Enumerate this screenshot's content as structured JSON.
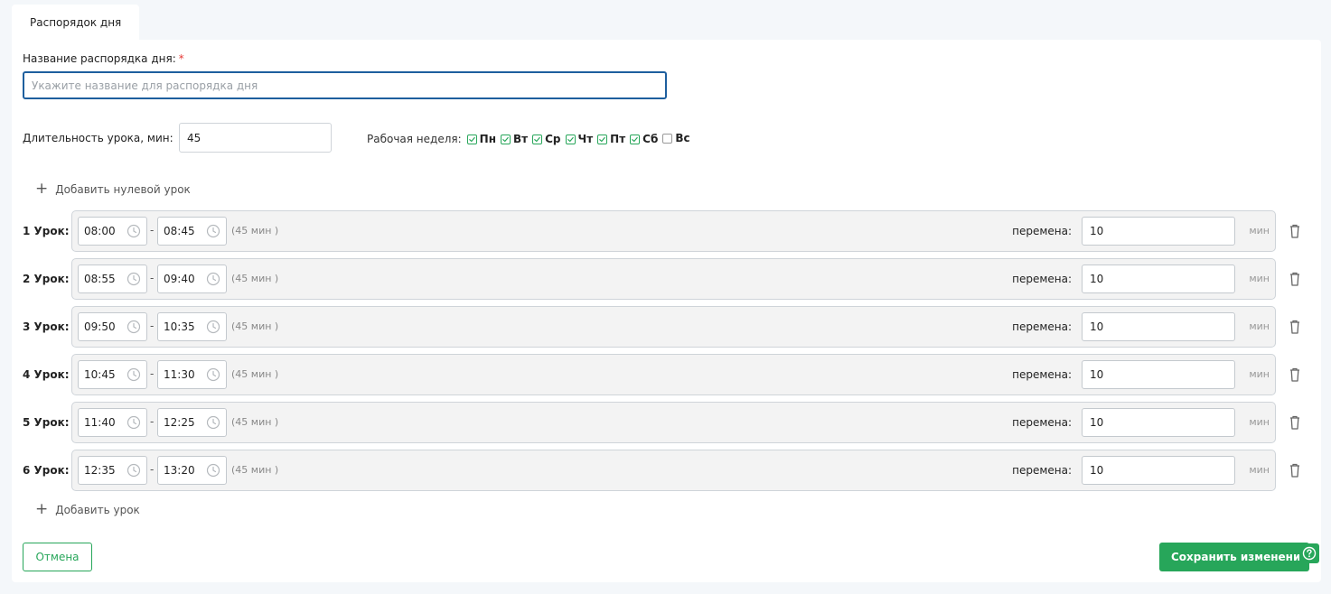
{
  "tab": {
    "label": "Распорядок дня"
  },
  "name_field": {
    "label": "Название распорядка дня:",
    "required_mark": "*",
    "placeholder": "Укажите название для распорядка дня",
    "value": ""
  },
  "duration": {
    "label": "Длительность урока, мин:",
    "value": "45"
  },
  "work_week": {
    "label": "Рабочая неделя:",
    "days": [
      {
        "label": "Пн",
        "checked": true
      },
      {
        "label": "Вт",
        "checked": true
      },
      {
        "label": "Ср",
        "checked": true
      },
      {
        "label": "Чт",
        "checked": true
      },
      {
        "label": "Пт",
        "checked": true
      },
      {
        "label": "Сб",
        "checked": true
      },
      {
        "label": "Вс",
        "checked": false
      }
    ]
  },
  "add_zero_lesson": {
    "label": "Добавить нулевой урок"
  },
  "lessons": [
    {
      "label": "1 Урок:",
      "start": "08:00",
      "end": "08:45",
      "duration": "(45 мин )",
      "break_label": "перемена:",
      "break_value": "10",
      "unit": "мин"
    },
    {
      "label": "2 Урок:",
      "start": "08:55",
      "end": "09:40",
      "duration": "(45 мин )",
      "break_label": "перемена:",
      "break_value": "10",
      "unit": "мин"
    },
    {
      "label": "3 Урок:",
      "start": "09:50",
      "end": "10:35",
      "duration": "(45 мин )",
      "break_label": "перемена:",
      "break_value": "10",
      "unit": "мин"
    },
    {
      "label": "4 Урок:",
      "start": "10:45",
      "end": "11:30",
      "duration": "(45 мин )",
      "break_label": "перемена:",
      "break_value": "10",
      "unit": "мин"
    },
    {
      "label": "5 Урок:",
      "start": "11:40",
      "end": "12:25",
      "duration": "(45 мин )",
      "break_label": "перемена:",
      "break_value": "10",
      "unit": "мин"
    },
    {
      "label": "6 Урок:",
      "start": "12:35",
      "end": "13:20",
      "duration": "(45 мин )",
      "break_label": "перемена:",
      "break_value": "10",
      "unit": "мин"
    }
  ],
  "add_lesson": {
    "label": "Добавить урок"
  },
  "buttons": {
    "cancel": "Отмена",
    "save": "Сохранить изменения"
  },
  "colors": {
    "accent": "#27a65a",
    "focus_border": "#1e5f9e",
    "required": "#e53935"
  },
  "icons": {
    "clock": "clock-icon",
    "trash": "trash-icon",
    "help": "help-icon",
    "plus": "plus-icon",
    "check": "check-icon"
  }
}
